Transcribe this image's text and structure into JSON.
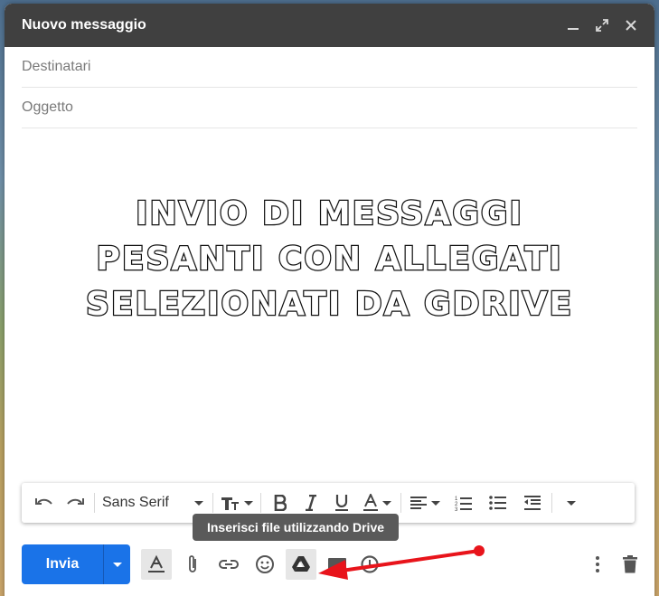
{
  "window": {
    "title": "Nuovo messaggio"
  },
  "fields": {
    "to_placeholder": "Destinatari",
    "subject_placeholder": "Oggetto"
  },
  "body": {
    "lines": [
      "INVIO DI MESSAGGI",
      "PESANTI CON ALLEGATI",
      "SELEZIONATI DA GDRIVE"
    ]
  },
  "format_toolbar": {
    "font": "Sans Serif"
  },
  "tooltip": {
    "text": "Inserisci file utilizzando Drive"
  },
  "bottom_bar": {
    "send_label": "Invia"
  },
  "colors": {
    "accent": "#1a73e8",
    "header": "#404040",
    "arrow": "#e8141b"
  },
  "icons": [
    "minimize-icon",
    "expand-icon",
    "close-icon",
    "undo-icon",
    "redo-icon",
    "text-size-icon",
    "bold-icon",
    "italic-icon",
    "underline-icon",
    "text-color-icon",
    "align-icon",
    "numbered-list-icon",
    "bulleted-list-icon",
    "indent-less-icon",
    "more-formatting-icon",
    "formatting-options-icon",
    "attach-icon",
    "link-icon",
    "emoji-icon",
    "drive-icon",
    "photo-icon",
    "schedule-icon",
    "more-options-icon",
    "trash-icon"
  ]
}
